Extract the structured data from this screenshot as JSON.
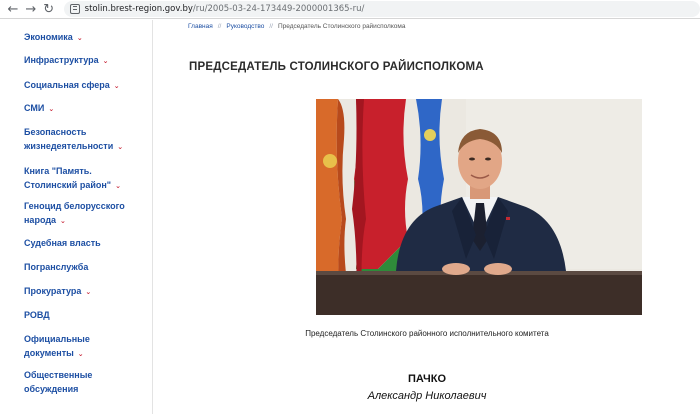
{
  "browser": {
    "url_domain": "stolin.brest-region.gov.by",
    "url_path": "/ru/2005-03-24-173449-2000001365-ru/"
  },
  "sidebar": {
    "items": [
      {
        "label": "Экономика",
        "has_submenu": true
      },
      {
        "label": "Инфраструктура",
        "has_submenu": true
      },
      {
        "label": "Социальная сфера",
        "has_submenu": true
      },
      {
        "label": "СМИ",
        "has_submenu": true
      },
      {
        "label_lines": [
          "Безопасность",
          "жизнедеятельности"
        ],
        "has_submenu": true
      },
      {
        "label_lines": [
          "Книга \"Память.",
          "Столинский район\""
        ],
        "has_submenu": true
      },
      {
        "label_lines": [
          "Геноцид белорусского",
          "народа"
        ],
        "has_submenu": true
      },
      {
        "label": "Судебная власть",
        "has_submenu": false
      },
      {
        "label": "Погранслужба",
        "has_submenu": false
      },
      {
        "label": "Прокуратура",
        "has_submenu": true
      },
      {
        "label": "РОВД",
        "has_submenu": false
      },
      {
        "label_lines": [
          "Официальные",
          "документы"
        ],
        "has_submenu": true
      },
      {
        "label_lines": [
          "Общественные",
          "обсуждения"
        ],
        "has_submenu": false
      }
    ]
  },
  "breadcrumb": {
    "items": [
      "Главная",
      "Руководство",
      "Председатель Столинского райисполкома"
    ],
    "separator": "//"
  },
  "page": {
    "title": "ПРЕДСЕДАТЕЛЬ СТОЛИНСКОГО РАЙИСПОЛКОМА",
    "caption": "Председатель Столинского районного исполнительного комитета",
    "surname": "ПАЧКО",
    "name": "Александр Николаевич"
  },
  "colors": {
    "link": "#1d4fa3",
    "chevron": "#c8283a",
    "title": "#2b2b2b"
  }
}
